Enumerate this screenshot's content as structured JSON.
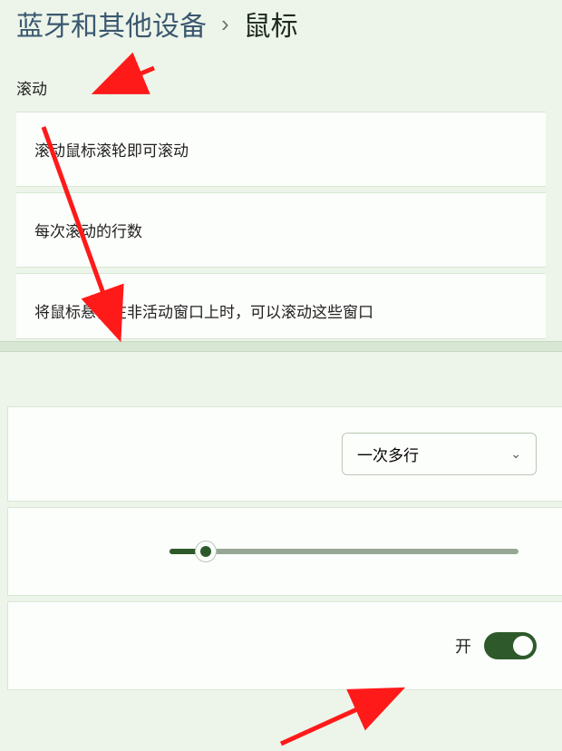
{
  "breadcrumb": {
    "parent": "蓝牙和其他设备",
    "separator": "›",
    "current": "鼠标"
  },
  "section_label": "滚动",
  "rows": {
    "wheel_scroll": "滚动鼠标滚轮即可滚动",
    "lines_each": "每次滚动的行数",
    "inactive_hover": "将鼠标悬停在非活动窗口上时，可以滚动这些窗口"
  },
  "controls": {
    "dropdown_value": "一次多行",
    "toggle_label": "开"
  }
}
